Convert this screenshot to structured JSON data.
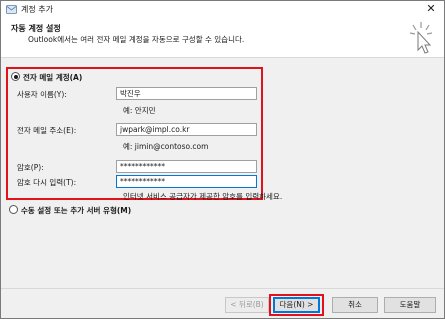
{
  "window": {
    "title": "계정 추가",
    "close_glyph": "✕"
  },
  "header": {
    "title": "자동 계정 설정",
    "description": "Outlook에서는 여러 전자 메일 계정을 자동으로 구성할 수 있습니다."
  },
  "email_account": {
    "radio_label": "전자 메일 계정(A)",
    "selected": true,
    "name": {
      "label": "사용자 이름(Y):",
      "value": "박진우",
      "example": "예: 안지민"
    },
    "email": {
      "label": "전자 메일 주소(E):",
      "value": "jwpark@impl.co.kr",
      "example": "예: jimin@contoso.com"
    },
    "password": {
      "label": "암호(P):",
      "value": "************"
    },
    "confirm_password": {
      "label": "암호 다시 입력(T):",
      "value": "************",
      "hint": "인터넷 서비스 공급자가 제공한 암호를 입력하세요."
    }
  },
  "manual_setup": {
    "radio_label": "수동 설정 또는 추가 서버 유형(M)",
    "selected": false
  },
  "buttons": {
    "back": "< 뒤로(B)",
    "next": "다음(N) >",
    "cancel": "취소",
    "help": "도움말"
  },
  "colors": {
    "highlight": "#e0131c",
    "primary_border": "#0078d7"
  }
}
